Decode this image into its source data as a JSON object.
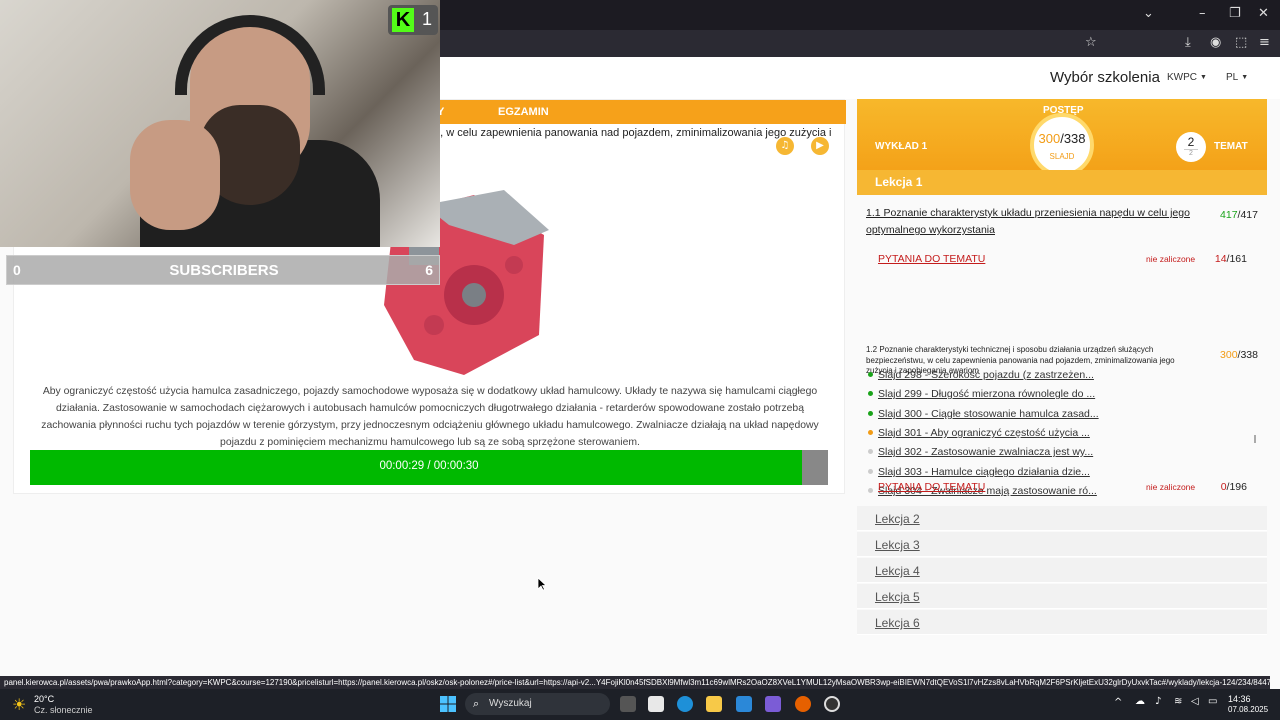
{
  "browser": {
    "url": "panel.kierowca.pl/assets/pwa/prawkoApp.html?category=KWPC&course=127190&pricelisturl=https://panel.kierowca.pl/oskz/osk-polonez#/price-list&url=https://api-v2...Y4FojiKl0n45fSDBXl9Mfwl3m11c69wlMRs2OaOZ8XVeL1YMUL12yMsaOWBR3wp-eiBIEWN7dtQEVoS1l7vHZzs8vLaHVbRqM2F6PSrKljetExU32glrDyUxvkTac#/wyklady/lekcja-124/234/84470"
  },
  "header": {
    "choose_training": "Wybór szkolenia",
    "course": "KWPC",
    "lang": "PL"
  },
  "tabs": [
    "Y",
    "EGZAMIN"
  ],
  "slide": {
    "title": "u, w celu zapewnienia panowania nad pojazdem, zminimalizowania jego zużycia i",
    "description": "Aby ograniczyć częstość użycia hamulca zasadniczego, pojazdy samochodowe wyposaża się w dodatkowy układ hamulcowy. Układy te nazywa się hamulcami ciągłego działania. Zastosowanie w samochodach ciężarowych i autobusach hamulców pomocniczych długotrwałego działania - retarderów spowodowane zostało potrzebą zachowania płynności ruchu tych pojazdów w terenie górzystym, przy jednoczesnym odciążeniu głównego układu hamulcowego. Zwalniacze działają na układ napędowy pojazdu z pominięciem mechanizmu hamulcowego lub są ze sobą sprzężone sterowaniem.",
    "timer": "00:00:29 / 00:00:30",
    "progress_pct": 96.7
  },
  "stats": {
    "lecture": "WYKŁAD 1",
    "progress_label": "POSTĘP",
    "progress_current": "300",
    "progress_sep": "/",
    "progress_total": "338",
    "slide_label": "SLAJD",
    "topic_num": "2",
    "topic_den": "2",
    "topic_label": "TEMAT"
  },
  "lessons": {
    "active": "Lekcja 1",
    "topic1": {
      "title": "1.1 Poznanie charakterystyk układu przeniesienia napędu w celu jego optymalnego wykorzystania",
      "done": "417",
      "sep": "/",
      "total": "417"
    },
    "questions1": {
      "label": "PYTANIA DO TEMATU",
      "status": "nie zaliczone",
      "done": "14",
      "sep": "/",
      "total": "161"
    },
    "topic2": {
      "title": "1.2 Poznanie charakterystyki technicznej i sposobu działania urządzeń służących bezpieczeństwu, w celu zapewnienia panowania nad pojazdem, zminimalizowania jego zużycia i zapobiegania awariom",
      "done": "300",
      "sep": "/",
      "total": "338"
    },
    "slides": [
      {
        "label": "Slajd 298 - Szerokość pojazdu (z zastrzeżen...",
        "state": "done"
      },
      {
        "label": "Slajd 299 - Długość mierzona równolegle do ...",
        "state": "done"
      },
      {
        "label": "Slajd 300 - Ciągłe stosowanie hamulca zasad...",
        "state": "done"
      },
      {
        "label": "Slajd 301 - Aby ograniczyć częstość użycia ...",
        "state": "current"
      },
      {
        "label": "Slajd 302 - Zastosowanie zwalniacza jest wy...",
        "state": "todo"
      },
      {
        "label": "Slajd 303 - Hamulce ciągłego działania dzie...",
        "state": "todo"
      },
      {
        "label": "Slajd 304 - Zwalniacze mają zastosowanie ró...",
        "state": "todo"
      }
    ],
    "questions2": {
      "label": "PYTANIA DO TEMATU",
      "status": "nie zaliczone",
      "done": "0",
      "sep": "/",
      "total": "196"
    },
    "others": [
      "Lekcja 2",
      "Lekcja 3",
      "Lekcja 4",
      "Lekcja 5",
      "Lekcja 6"
    ]
  },
  "overlay": {
    "kick_count": "1",
    "kick_logo": "K",
    "subs_left": "0",
    "subs_label": "SUBSCRIBERS",
    "subs_right": "6"
  },
  "taskbar": {
    "weather_temp": "20°C",
    "weather_desc": "Cz. słonecznie",
    "search_placeholder": "Wyszukaj",
    "time": "14:36",
    "date": "07.08.2025"
  },
  "colors": {
    "accent": "#f6a11a",
    "progress": "#00b900",
    "fail": "#c41c1c"
  }
}
